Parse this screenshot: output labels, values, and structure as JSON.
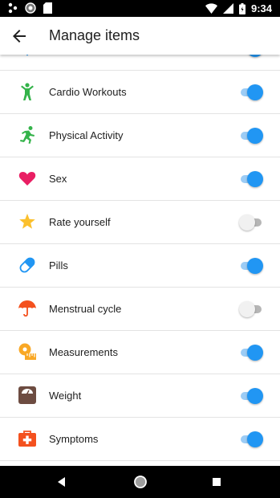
{
  "status_bar": {
    "time": "9:34",
    "icons": [
      "wind-icon",
      "circle-icon",
      "sd-card-icon",
      "wifi-icon",
      "signal-icon",
      "battery-icon"
    ]
  },
  "app_bar": {
    "title": "Manage items",
    "back_icon": "arrow-back-icon"
  },
  "items": [
    {
      "label": "",
      "icon": "partial-icon",
      "enabled": true
    },
    {
      "label": "Cardio Workouts",
      "icon": "stickman-icon",
      "enabled": true
    },
    {
      "label": "Physical Activity",
      "icon": "runner-icon",
      "enabled": true
    },
    {
      "label": "Sex",
      "icon": "heart-icon",
      "enabled": true
    },
    {
      "label": "Rate yourself",
      "icon": "star-icon",
      "enabled": false
    },
    {
      "label": "Pills",
      "icon": "pill-icon",
      "enabled": true
    },
    {
      "label": "Menstrual cycle",
      "icon": "umbrella-icon",
      "enabled": false
    },
    {
      "label": "Measurements",
      "icon": "tape-measure-icon",
      "enabled": true
    },
    {
      "label": "Weight",
      "icon": "scale-icon",
      "enabled": true
    },
    {
      "label": "Symptoms",
      "icon": "first-aid-kit-icon",
      "enabled": true
    }
  ],
  "nav_bar": {
    "icons": [
      "back-triangle-icon",
      "home-circle-icon",
      "recents-square-icon"
    ]
  },
  "colors": {
    "toggle_on_thumb": "#2196f3",
    "toggle_on_track": "#9cccf5",
    "toggle_off_thumb": "#f1f1f1",
    "toggle_off_track": "#b6b6b6"
  }
}
